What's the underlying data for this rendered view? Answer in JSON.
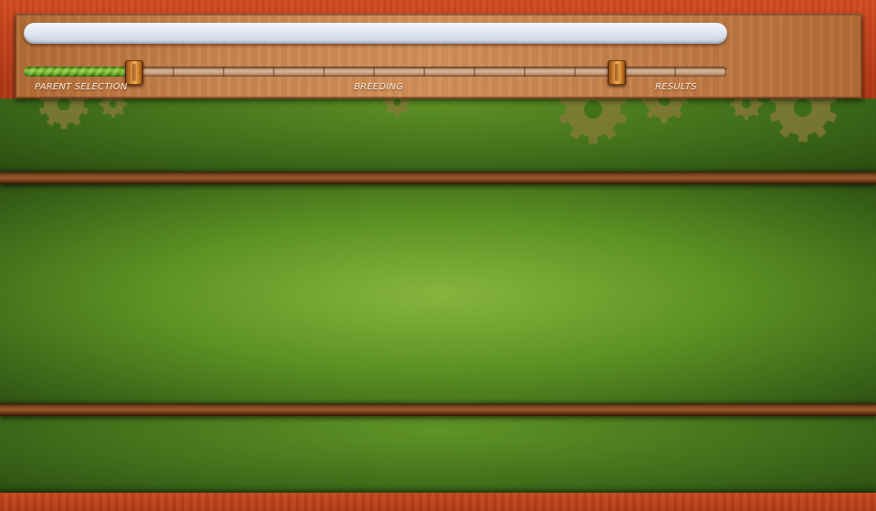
{
  "search": {
    "placeholder": "",
    "value": ""
  },
  "progress": {
    "steps": [
      {
        "label": "PARENT SELECTION"
      },
      {
        "label": "BREEDING"
      },
      {
        "label": "RESULTS"
      }
    ],
    "fill_fraction": 0.16,
    "handles": [
      {
        "name": "start-handle",
        "position_fraction": 0.157
      },
      {
        "name": "end-handle",
        "position_fraction": 0.843
      }
    ]
  },
  "colors": {
    "frame_red": "#c1401b",
    "felt_green": "#5d9422",
    "panel_wood": "#c98550",
    "progress_green": "#8fd13a",
    "label_cream": "#fbf1e2"
  },
  "icons": {
    "decor": "gear-icon"
  }
}
